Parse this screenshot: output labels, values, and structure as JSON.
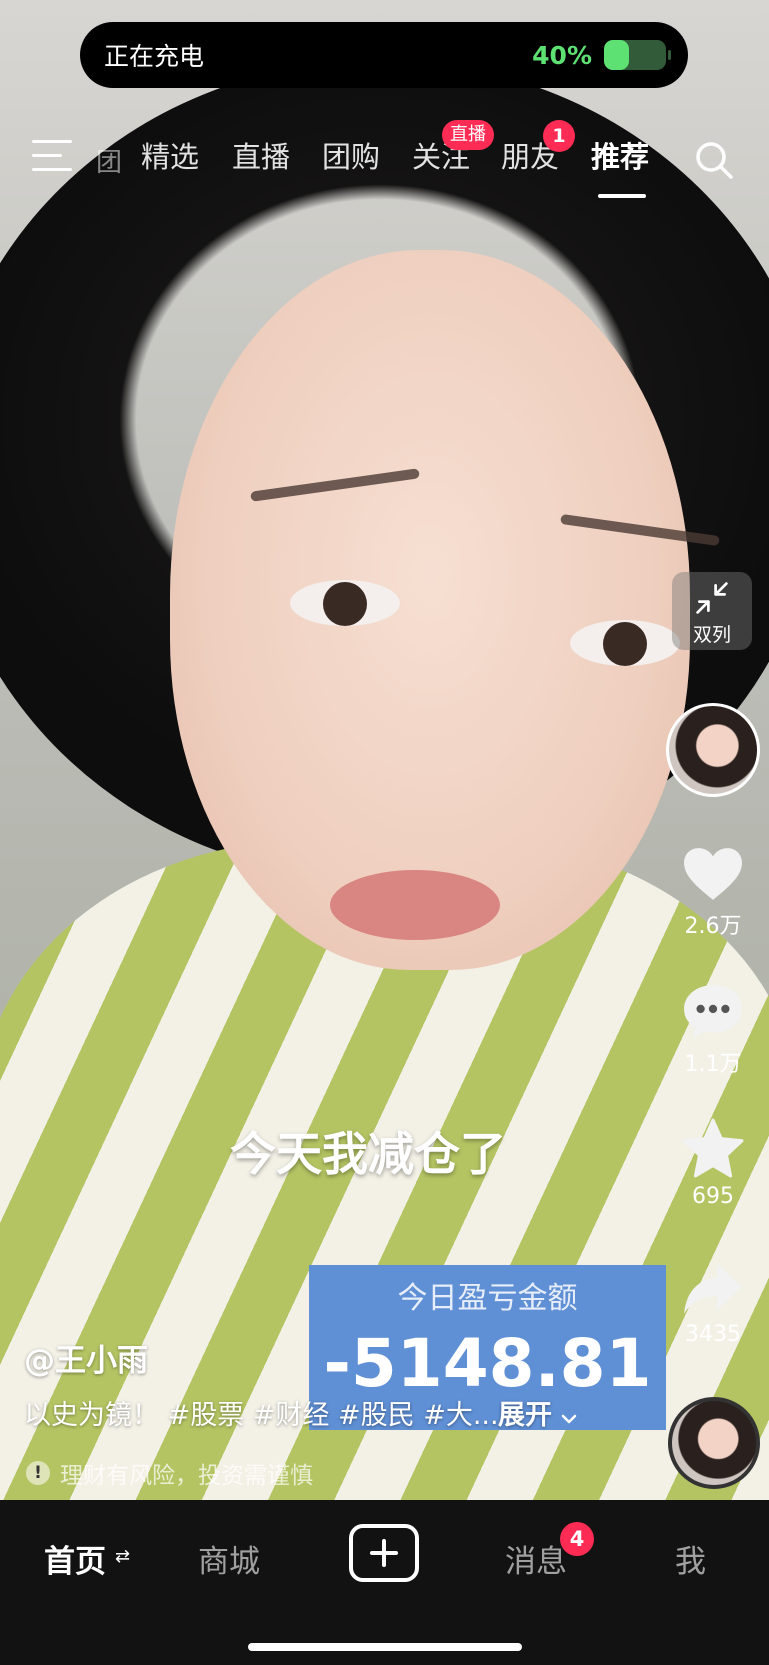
{
  "status": {
    "charging_text": "正在充电",
    "battery_percent_text": "40%",
    "battery_level": 0.4
  },
  "top_nav": {
    "faded_tab": "团",
    "tabs": [
      "精选",
      "直播",
      "团购",
      "关注",
      "朋友",
      "推荐"
    ],
    "active_tab": "推荐",
    "follow_badge": "直播",
    "friends_badge": "1"
  },
  "dual_column": {
    "label": "双列"
  },
  "actions": {
    "likes": "2.6万",
    "comments": "1.1万",
    "favorites": "695",
    "shares": "3435"
  },
  "video": {
    "caption": "今天我减仓了",
    "pnl_label": "今日盈亏金额",
    "pnl_amount": "-5148.81"
  },
  "post": {
    "author": "@王小雨",
    "description": "以史为镜！ #股票 #财经 #股民 #大...",
    "expand": "展开",
    "risk_notice": "理财有风险，投资需谨慎"
  },
  "bottom_tabs": {
    "home": "首页",
    "mall": "商城",
    "messages": "消息",
    "messages_badge": "4",
    "me": "我"
  },
  "colors": {
    "accent_red": "#fe2c55",
    "battery_green": "#5ee173",
    "bottom_bar": "#121212"
  }
}
